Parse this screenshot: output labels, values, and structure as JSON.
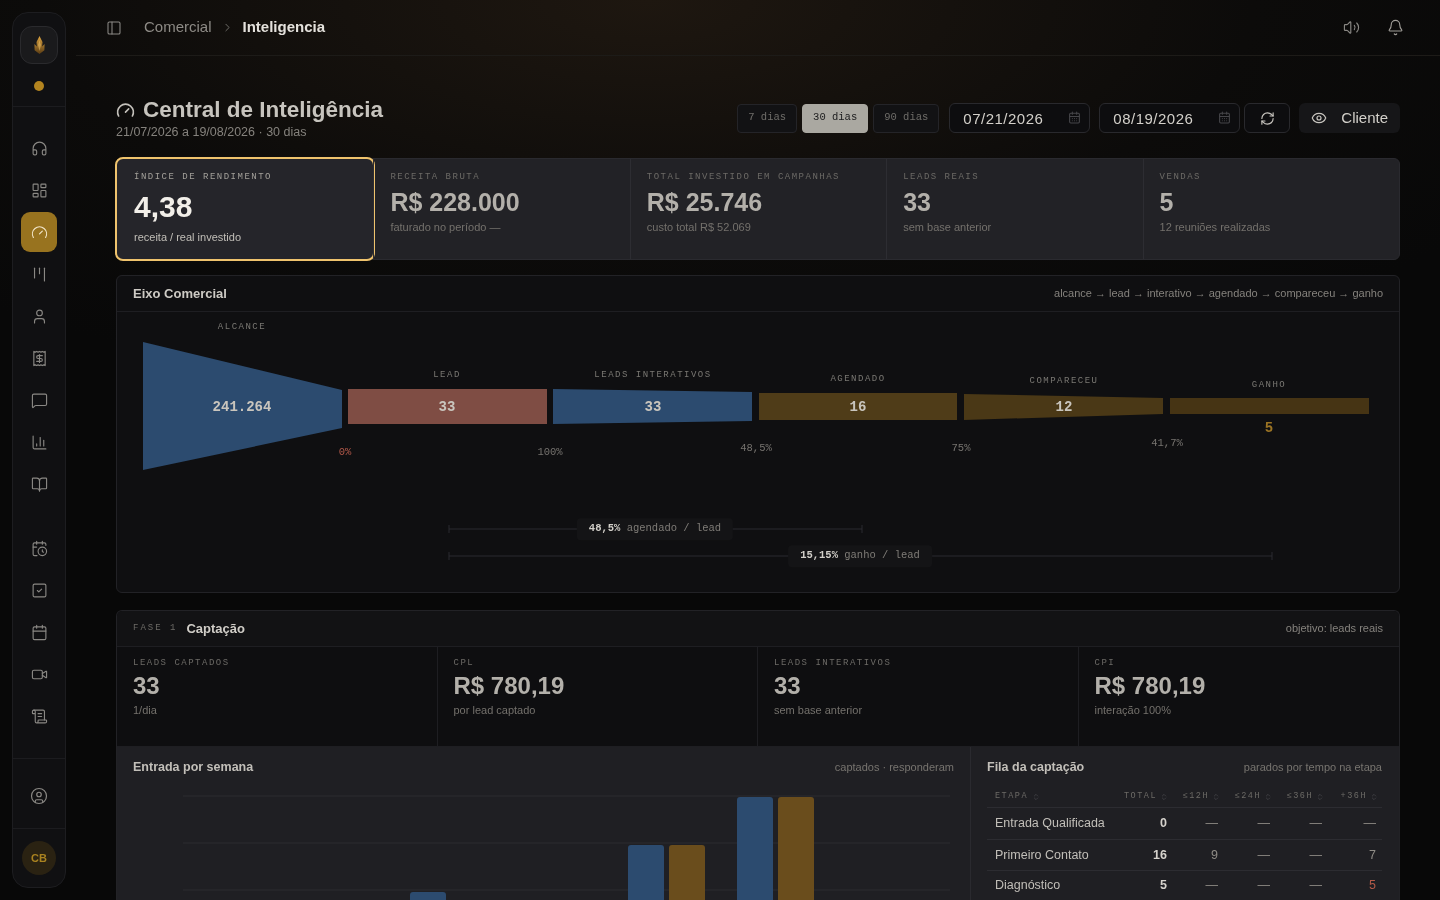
{
  "sidebar": {
    "groups": [
      {
        "items": [
          {
            "selected": false
          },
          {
            "selected": false
          },
          {
            "selected": true
          },
          {
            "selected": false
          },
          {
            "selected": false
          },
          {
            "selected": false
          },
          {
            "selected": false
          },
          {
            "selected": false
          },
          {
            "selected": false
          }
        ]
      },
      {
        "items": [
          {
            "selected": false
          },
          {
            "selected": false
          },
          {
            "selected": false
          },
          {
            "selected": false
          },
          {
            "selected": false
          }
        ]
      }
    ],
    "avatar": {
      "initials": "CB"
    }
  },
  "header": {
    "breadcrumb": [
      {
        "label": "Comercial",
        "current": false
      },
      {
        "label": "Inteligencia",
        "current": true
      }
    ]
  },
  "page": {
    "title": "Central de Inteligência",
    "subtitle": "21/07/2026 a 19/08/2026 · 30 dias"
  },
  "range_buttons": [
    {
      "label": "7 dias",
      "selected": false
    },
    {
      "label": "30 dias",
      "selected": true
    },
    {
      "label": "90 dias",
      "selected": false
    }
  ],
  "date_from": {
    "value": "07/21/2026"
  },
  "date_to": {
    "value": "08/19/2026"
  },
  "client_button": {
    "label": "Cliente"
  },
  "kpis": [
    {
      "label": "ÍNDICE DE RENDIMENTO",
      "value": "4,38",
      "note": "receita / real investido",
      "selected": true
    },
    {
      "label": "RECEITA BRUTA",
      "value": "R$ 228.000",
      "note": "faturado no período —",
      "selected": false
    },
    {
      "label": "TOTAL INVESTIDO EM CAMPANHAS",
      "value": "R$ 25.746",
      "note": "custo total R$ 52.069",
      "selected": false
    },
    {
      "label": "LEADS REAIS",
      "value": "33",
      "note": "sem base anterior",
      "selected": false
    },
    {
      "label": "VENDAS",
      "value": "5",
      "note": "12 reuniões realizadas",
      "selected": false
    }
  ],
  "funnel": {
    "title": "Eixo Comercial",
    "flow": "alcance → lead → interativo → agendado → compareceu → ganho",
    "stages": [
      {
        "label": "ALCANCE",
        "value": "241.264",
        "color": "#2c4b6f",
        "kind": "inside"
      },
      {
        "label": "LEAD",
        "value": "33",
        "color": "#7f4d44",
        "kind": "inside",
        "rate": "0%",
        "rate_alert": true
      },
      {
        "label": "LEADS INTERATIVOS",
        "value": "33",
        "color": "#2c4b6f",
        "kind": "inside",
        "rate": "100%",
        "rate_alert": false
      },
      {
        "label": "AGENDADO",
        "value": "16",
        "color": "#4f3c18",
        "kind": "inside",
        "rate": "48,5%",
        "rate_alert": false
      },
      {
        "label": "COMPARECEU",
        "value": "12",
        "color": "#4a3816",
        "kind": "inside",
        "rate": "75%",
        "rate_alert": false
      },
      {
        "label": "GANHO",
        "value": "5",
        "color": "#463414",
        "kind": "below",
        "rate": "41,7%",
        "rate_alert": false
      }
    ],
    "spans": [
      {
        "text": "**48,5%** agendado / lead"
      },
      {
        "text": "**15,15%** ganho / lead"
      }
    ]
  },
  "phase": {
    "tag": "FASE 1",
    "title": "Captação",
    "goal": "objetivo: leads reais",
    "metrics": [
      {
        "label": "LEADS CAPTADOS",
        "value": "33",
        "note": "1/dia"
      },
      {
        "label": "CPL",
        "value": "R$ 780,19",
        "note": "por lead captado"
      },
      {
        "label": "LEADS INTERATIVOS",
        "value": "33",
        "note": "sem base anterior"
      },
      {
        "label": "CPI",
        "value": "R$ 780,19",
        "note": "interação 100%"
      }
    ],
    "weekly": {
      "title": "Entrada por semana",
      "legend": "captados · responderam"
    },
    "queue": {
      "title": "Fila da captação",
      "note": "parados por tempo na etapa",
      "columns": [
        "ETAPA",
        "TOTAL",
        "≤12H",
        "≤24H",
        "≤36H",
        "+36H"
      ],
      "rows": [
        {
          "stage": "Entrada Qualificada",
          "total": "0",
          "buckets": [
            {
              "text": "—",
              "alert": false
            },
            {
              "text": "—",
              "alert": false
            },
            {
              "text": "—",
              "alert": false
            },
            {
              "text": "—",
              "alert": false
            }
          ]
        },
        {
          "stage": "Primeiro Contato",
          "total": "16",
          "buckets": [
            {
              "text": "9",
              "alert": false
            },
            {
              "text": "—",
              "alert": false
            },
            {
              "text": "—",
              "alert": false
            },
            {
              "text": "7",
              "alert": false
            }
          ]
        },
        {
          "stage": "Diagnóstico",
          "total": "5",
          "buckets": [
            {
              "text": "—",
              "alert": false
            },
            {
              "text": "—",
              "alert": false
            },
            {
              "text": "—",
              "alert": false
            },
            {
              "text": "5",
              "alert": true
            }
          ]
        }
      ]
    }
  }
}
